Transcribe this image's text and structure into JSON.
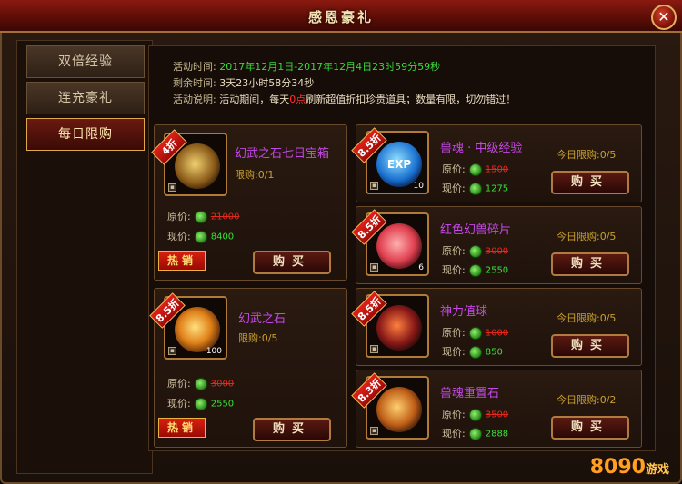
{
  "window": {
    "title": "感恩豪礼",
    "close_icon": "close-icon"
  },
  "sidebar": {
    "items": [
      {
        "label": "双倍经验",
        "active": false
      },
      {
        "label": "连充豪礼",
        "active": false
      },
      {
        "label": "每日限购",
        "active": true
      }
    ]
  },
  "info": {
    "time_label": "活动时间:",
    "time_value": "2017年12月1日-2017年12月4日23时59分59秒",
    "remain_label": "剩余时间:",
    "remain_value": "3天23小时58分34秒",
    "desc_label": "活动说明:",
    "desc_prefix": "活动期间，每天",
    "desc_highlight": "0点",
    "desc_suffix": "刷新超值折扣珍贵道具；数量有限，切勿错过！"
  },
  "labels": {
    "original_price": "原价:",
    "current_price": "现价:",
    "buy": "购买",
    "hot": "热销",
    "limit_prefix": "限购:",
    "daily_limit_prefix": "今日限购:"
  },
  "left_items": [
    {
      "discount": "4折",
      "name": "幻武之石七日宝箱",
      "limit": "0/1",
      "original": "21000",
      "current": "8400",
      "count": "",
      "hot": true
    },
    {
      "discount": "8.5折",
      "name": "幻武之石",
      "limit": "0/5",
      "original": "3000",
      "current": "2550",
      "count": "100",
      "hot": true
    }
  ],
  "right_items": [
    {
      "discount": "8.5折",
      "name": "兽魂 · 中级经验",
      "limit": "0/5",
      "original": "1500",
      "current": "1275",
      "count": "10",
      "icon_text": "EXP"
    },
    {
      "discount": "8.5折",
      "name": "红色幻兽碎片",
      "limit": "0/5",
      "original": "3000",
      "current": "2550",
      "count": "6",
      "icon_text": ""
    },
    {
      "discount": "8.5折",
      "name": "神力值球",
      "limit": "0/5",
      "original": "1000",
      "current": "850",
      "count": "",
      "icon_text": ""
    },
    {
      "discount": "8.3折",
      "name": "兽魂重置石",
      "limit": "0/2",
      "original": "3500",
      "current": "2888",
      "count": "",
      "icon_text": ""
    }
  ],
  "watermark": {
    "brand": "8090",
    "suffix": "游戏"
  },
  "colors": {
    "name_purple": "#c448e8",
    "price_green": "#38e038",
    "price_red": "#e02a20",
    "limit_gold": "#c8a030"
  }
}
